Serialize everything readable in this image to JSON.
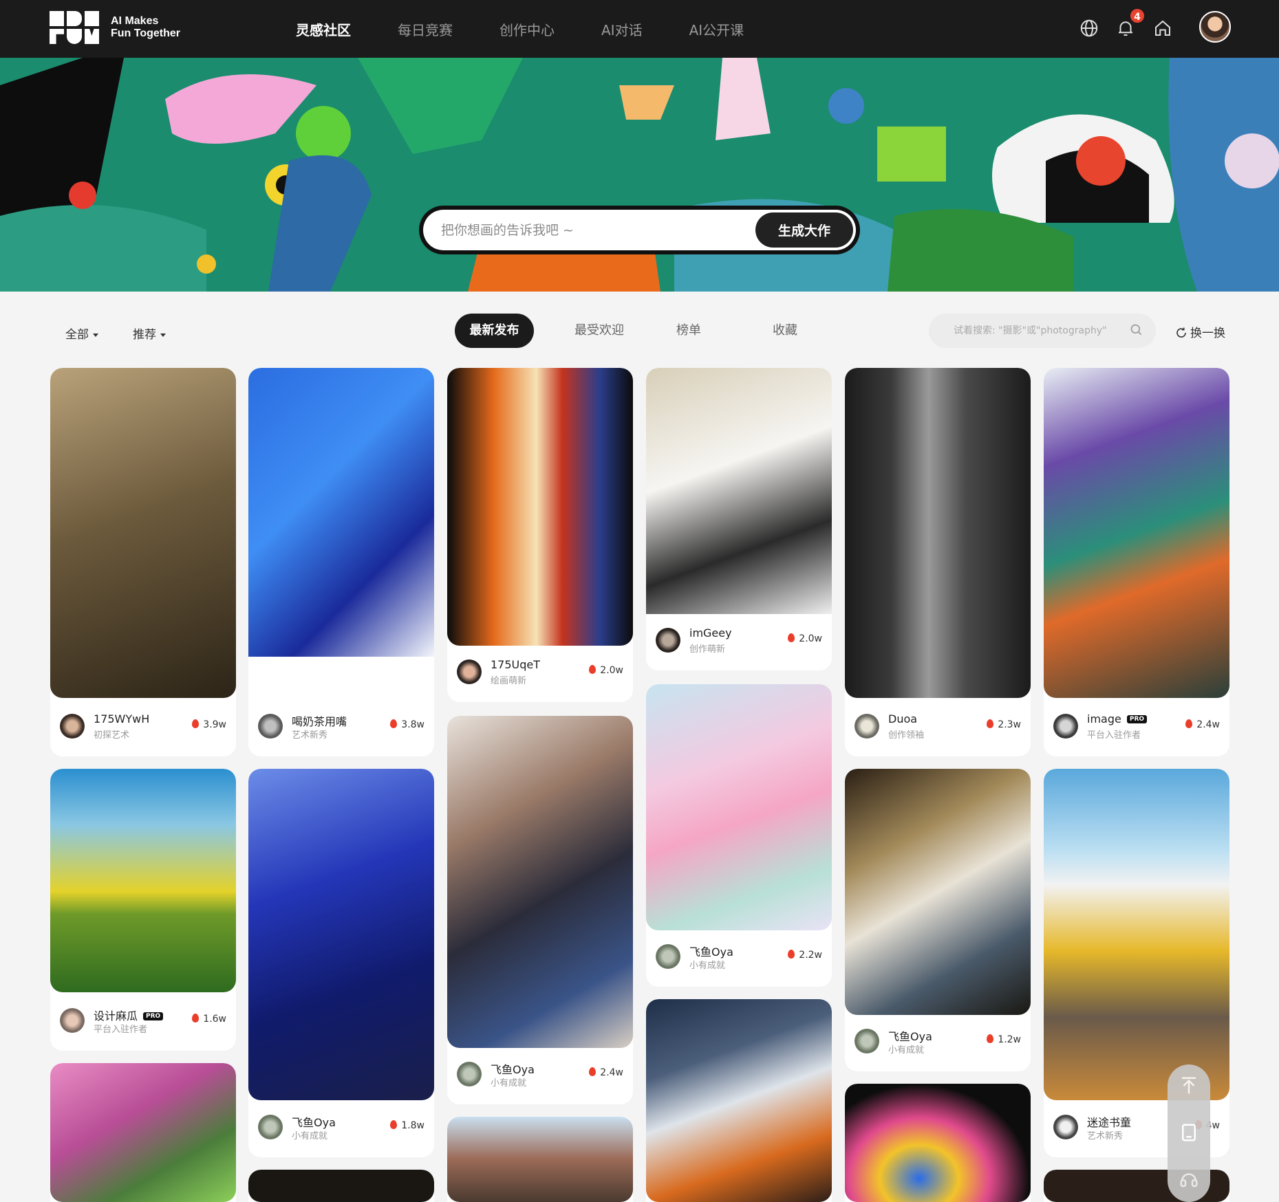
{
  "brand": {
    "line1": "AI Makes",
    "line2": "Fun Together"
  },
  "nav": {
    "items": [
      "灵感社区",
      "每日竞赛",
      "创作中心",
      "AI对话",
      "AI公开课"
    ],
    "active": 0
  },
  "header": {
    "notification_count": "4",
    "icons": [
      "globe-icon",
      "bell-icon",
      "home-icon"
    ]
  },
  "hero": {
    "placeholder": "把你想画的告诉我吧 ~",
    "generate_label": "生成大作"
  },
  "filters": {
    "category": "全部",
    "sort": "推荐"
  },
  "tabs": [
    "最新发布",
    "最受欢迎",
    "榜单",
    "收藏"
  ],
  "search": {
    "placeholder": "试着搜索: \"摄影\"或\"photography\""
  },
  "refresh_label": "换一换",
  "colors": {
    "topbar": "#1b1b1b",
    "accent_fire": "#ea3d2a",
    "badge": "#e8432f"
  },
  "columns": [
    [
      {
        "name": "175WYwH",
        "level": "初探艺术",
        "heat": "3.9w",
        "pro": false
      },
      {
        "name": "设计麻瓜",
        "level": "平台入驻作者",
        "heat": "1.6w",
        "pro": true
      },
      {
        "name": "",
        "level": "",
        "heat": "",
        "pro": false
      }
    ],
    [
      {
        "name": "喝奶茶用嘴",
        "level": "艺术新秀",
        "heat": "3.8w",
        "pro": false
      },
      {
        "name": "飞鱼Oya",
        "level": "小有成就",
        "heat": "1.8w",
        "pro": false
      },
      {
        "name": "",
        "level": "",
        "heat": "",
        "pro": false
      }
    ],
    [
      {
        "name": "175UqeT",
        "level": "绘画萌新",
        "heat": "2.0w",
        "pro": false
      },
      {
        "name": "飞鱼Oya",
        "level": "小有成就",
        "heat": "2.4w",
        "pro": false
      },
      {
        "name": "",
        "level": "",
        "heat": "",
        "pro": false
      }
    ],
    [
      {
        "name": "imGeey",
        "level": "创作萌新",
        "heat": "2.0w",
        "pro": false
      },
      {
        "name": "飞鱼Oya",
        "level": "小有成就",
        "heat": "2.2w",
        "pro": false
      },
      {
        "name": "",
        "level": "",
        "heat": "",
        "pro": false
      }
    ],
    [
      {
        "name": "Duoa",
        "level": "创作领袖",
        "heat": "2.3w",
        "pro": false
      },
      {
        "name": "飞鱼Oya",
        "level": "小有成就",
        "heat": "1.2w",
        "pro": false
      },
      {
        "name": "",
        "level": "",
        "heat": "",
        "pro": false
      }
    ],
    [
      {
        "name": "image",
        "level": "平台入驻作者",
        "heat": "2.4w",
        "pro": true
      },
      {
        "name": "迷途书童",
        "level": "艺术新秀",
        "heat": "4w",
        "pro": false
      },
      {
        "name": "",
        "level": "",
        "heat": "",
        "pro": false
      }
    ]
  ],
  "float_icons": [
    "back-to-top-icon",
    "feedback-icon",
    "support-headset-icon"
  ]
}
